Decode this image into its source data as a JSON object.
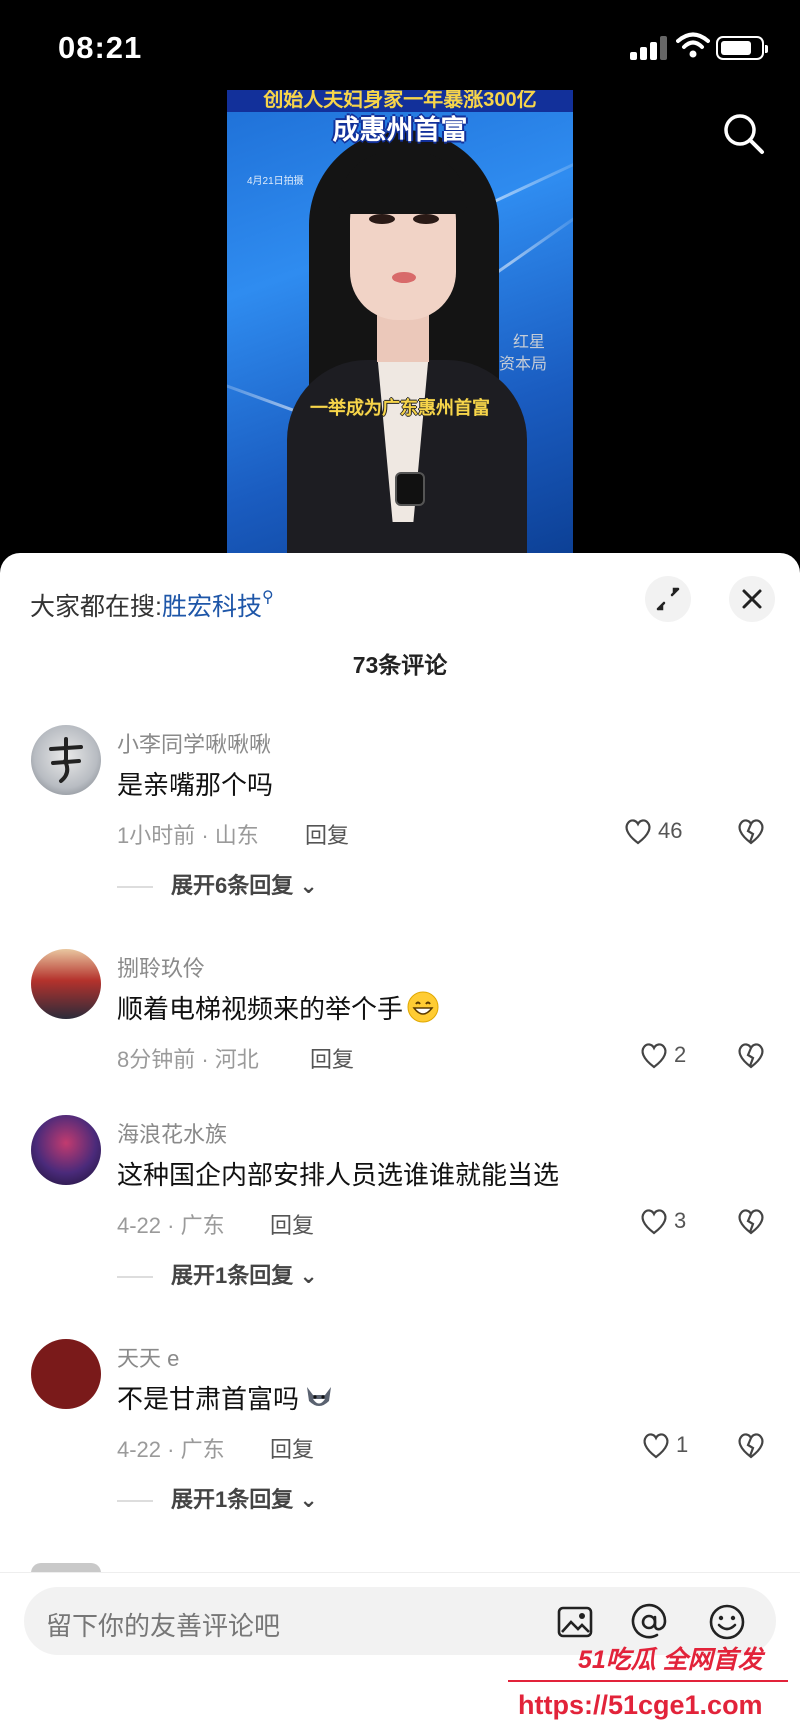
{
  "status_bar": {
    "time": "08:21"
  },
  "video": {
    "top_caption": "创始人夫妇身家一年暴涨300亿",
    "title": "成惠州首富",
    "date_stamp": "4月21日拍摄",
    "subtitle": "一举成为广东惠州首富",
    "watermark_line1": "红星",
    "watermark_line2": "资本局"
  },
  "sheet": {
    "hot_search_prefix": "大家都在搜:",
    "hot_search_keyword": "胜宏科技",
    "comment_count": "73条评论"
  },
  "comments": [
    {
      "username": "小李同学啾啾啾",
      "text": "是亲嘴那个吗",
      "meta": "1小时前 · 山东",
      "reply": "回复",
      "likes": "46",
      "more": "展开6条回复"
    },
    {
      "username": "捌聆玖伶",
      "text": "顺着电梯视频来的举个手",
      "emoji": "grinning-emoji",
      "meta": "8分钟前 · 河北",
      "reply": "回复",
      "likes": "2",
      "more": ""
    },
    {
      "username": "海浪花水族",
      "text": "这种国企内部安排人员选谁谁就能当选",
      "meta": "4-22 · 广东",
      "reply": "回复",
      "likes": "3",
      "more": "展开1条回复"
    },
    {
      "username": "天天 e",
      "text": "不是甘肃首富吗",
      "emoji": "husky-emoji",
      "meta": "4-22 · 广东",
      "reply": "回复",
      "likes": "1",
      "more": "展开1条回复"
    }
  ],
  "input": {
    "placeholder": "留下你的友善评论吧"
  },
  "overlay_watermark": {
    "brand": "51吃瓜 全网首发",
    "url": "https://51cge1.com"
  }
}
